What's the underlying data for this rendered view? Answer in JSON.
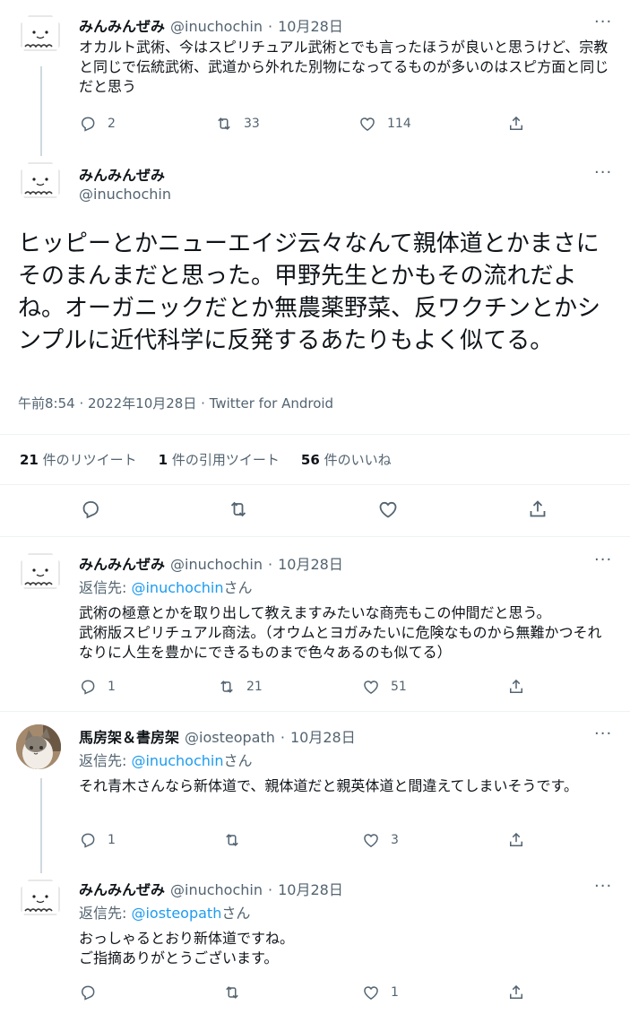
{
  "tweets": [
    {
      "name": "みんみんぜみ",
      "handle": "@inuchochin",
      "date": "10月28日",
      "text": "オカルト武術、今はスピリチュアル武術とでも言ったほうが良いと思うけど、宗教と同じで伝統武術、武道から外れた別物になってるものが多いのはスピ方面と同じだと思う",
      "reply": "2",
      "retweet": "33",
      "like": "114"
    }
  ],
  "main": {
    "name": "みんみんぜみ",
    "handle": "@inuchochin",
    "text": "ヒッピーとかニューエイジ云々なんて親体道とかまさにそのまんまだと思った。甲野先生とかもその流れだよね。オーガニックだとか無農薬野菜、反ワクチンとかシンプルに近代科学に反発するあたりもよく似てる。",
    "meta": "午前8:54 · 2022年10月28日 · Twitter for Android",
    "retweets_count": "21",
    "retweets_label": "件のリツイート",
    "quotes_count": "1",
    "quotes_label": "件の引用ツイート",
    "likes_count": "56",
    "likes_label": "件のいいね"
  },
  "replies": [
    {
      "name": "みんみんぜみ",
      "handle": "@inuchochin",
      "date": "10月28日",
      "reply_prefix": "返信先: ",
      "reply_to": "@inuchochin",
      "reply_suffix": "さん",
      "text": "武術の極意とかを取り出して教えますみたいな商売もこの仲間だと思う。\n武術版スピリチュアル商法。（オウムとヨガみたいに危険なものから無難かつそれなりに人生を豊かにできるものまで色々あるのも似てる）",
      "reply": "1",
      "retweet": "21",
      "like": "51"
    },
    {
      "name": "馬房架＆書房架",
      "handle": "@iosteopath",
      "date": "10月28日",
      "reply_prefix": "返信先: ",
      "reply_to": "@inuchochin",
      "reply_suffix": "さん",
      "text": "それ青木さんなら新体道で、親体道だと親英体道と間違えてしまいそうです。",
      "reply": "1",
      "retweet": "",
      "like": "3"
    },
    {
      "name": "みんみんぜみ",
      "handle": "@inuchochin",
      "date": "10月28日",
      "reply_prefix": "返信先: ",
      "reply_to": "@iosteopath",
      "reply_suffix": "さん",
      "text": "おっしゃるとおり新体道ですね。\nご指摘ありがとうございます。",
      "reply": "",
      "retweet": "",
      "like": "1"
    }
  ],
  "ui": {
    "more": "···",
    "separator": " · "
  },
  "colors": {
    "link": "#1d9bf0",
    "secondary": "#536471",
    "divider": "#eff3f4"
  }
}
